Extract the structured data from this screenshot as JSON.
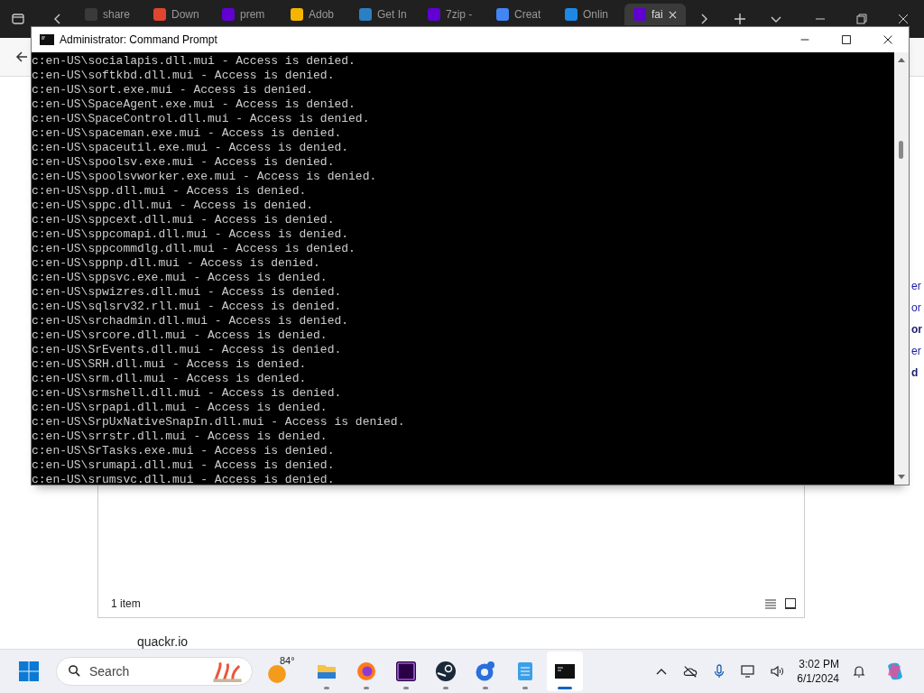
{
  "browser": {
    "tabs": [
      {
        "label": "share",
        "selected": false,
        "color": "#3a3a3a"
      },
      {
        "label": "Down",
        "selected": false,
        "color": "#e0452f"
      },
      {
        "label": "prem",
        "selected": false,
        "color": "#6001d2"
      },
      {
        "label": "Adob",
        "selected": false,
        "color": "#f4b400"
      },
      {
        "label": "Get In",
        "selected": false,
        "color": "#2b7fc4"
      },
      {
        "label": "7zip -",
        "selected": false,
        "color": "#6001d2"
      },
      {
        "label": "Creat",
        "selected": false,
        "color": "#4285f4"
      },
      {
        "label": "Onlin",
        "selected": false,
        "color": "#1e88e5"
      },
      {
        "label": "fai",
        "selected": true,
        "color": "#6001d2"
      }
    ],
    "page_fragments": [
      {
        "text": "er",
        "bold": false
      },
      {
        "text": "or",
        "bold": false
      },
      {
        "text": "or",
        "bold": true
      },
      {
        "text": "er",
        "bold": false
      },
      {
        "text": "d",
        "bold": true
      }
    ],
    "site_label": "quackr.io"
  },
  "explorer": {
    "status": "1 item"
  },
  "cmd": {
    "title": "Administrator: Command Prompt",
    "lines": [
      "c:en-US\\socialapis.dll.mui - Access is denied.",
      "c:en-US\\softkbd.dll.mui - Access is denied.",
      "c:en-US\\sort.exe.mui - Access is denied.",
      "c:en-US\\SpaceAgent.exe.mui - Access is denied.",
      "c:en-US\\SpaceControl.dll.mui - Access is denied.",
      "c:en-US\\spaceman.exe.mui - Access is denied.",
      "c:en-US\\spaceutil.exe.mui - Access is denied.",
      "c:en-US\\spoolsv.exe.mui - Access is denied.",
      "c:en-US\\spoolsvworker.exe.mui - Access is denied.",
      "c:en-US\\spp.dll.mui - Access is denied.",
      "c:en-US\\sppc.dll.mui - Access is denied.",
      "c:en-US\\sppcext.dll.mui - Access is denied.",
      "c:en-US\\sppcomapi.dll.mui - Access is denied.",
      "c:en-US\\sppcommdlg.dll.mui - Access is denied.",
      "c:en-US\\sppnp.dll.mui - Access is denied.",
      "c:en-US\\sppsvc.exe.mui - Access is denied.",
      "c:en-US\\spwizres.dll.mui - Access is denied.",
      "c:en-US\\sqlsrv32.rll.mui - Access is denied.",
      "c:en-US\\srchadmin.dll.mui - Access is denied.",
      "c:en-US\\srcore.dll.mui - Access is denied.",
      "c:en-US\\SrEvents.dll.mui - Access is denied.",
      "c:en-US\\SRH.dll.mui - Access is denied.",
      "c:en-US\\srm.dll.mui - Access is denied.",
      "c:en-US\\srmshell.dll.mui - Access is denied.",
      "c:en-US\\srpapi.dll.mui - Access is denied.",
      "c:en-US\\SrpUxNativeSnapIn.dll.mui - Access is denied.",
      "c:en-US\\srrstr.dll.mui - Access is denied.",
      "c:en-US\\SrTasks.exe.mui - Access is denied.",
      "c:en-US\\srumapi.dll.mui - Access is denied.",
      "c:en-US\\srumsvc.dll.mui - Access is denied."
    ]
  },
  "taskbar": {
    "search_placeholder": "Search",
    "weather": "84°",
    "apps": [
      {
        "kind": "files",
        "selected": false
      },
      {
        "kind": "firefox",
        "selected": false
      },
      {
        "kind": "premiere",
        "selected": false
      },
      {
        "kind": "steam",
        "selected": false
      },
      {
        "kind": "edge",
        "selected": false
      },
      {
        "kind": "notepad",
        "selected": false
      },
      {
        "kind": "terminal",
        "selected": true
      }
    ],
    "time": "3:02 PM",
    "date": "6/1/2024"
  }
}
